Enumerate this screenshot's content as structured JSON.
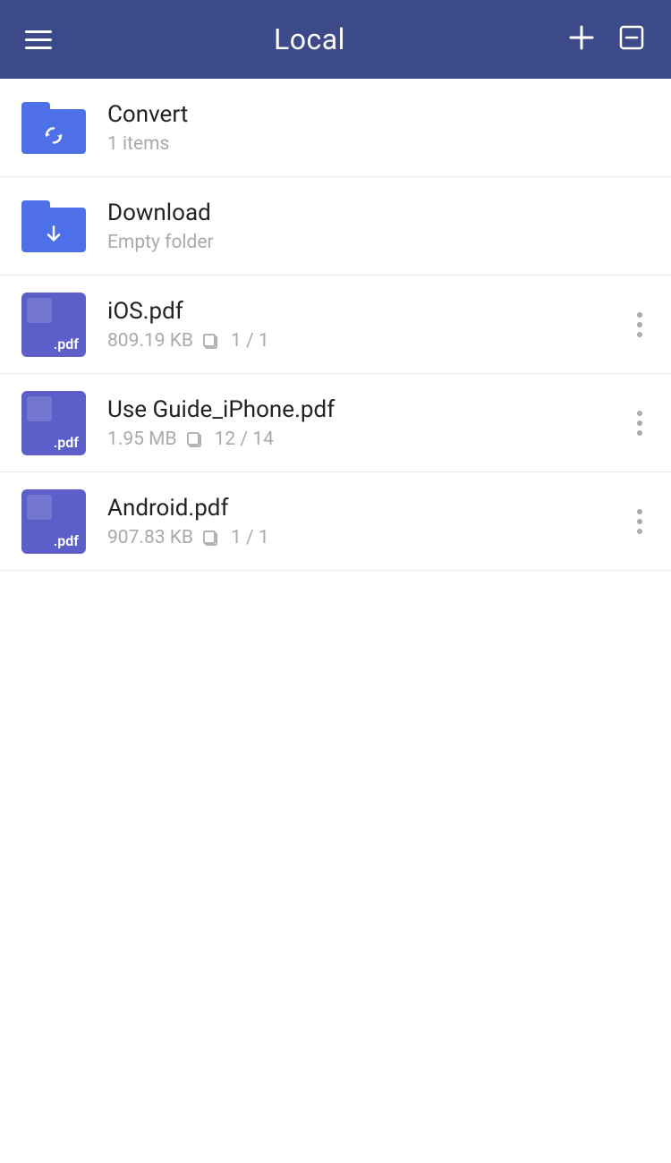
{
  "header": {
    "title": "Local",
    "menu_icon": "hamburger-icon",
    "add_icon": "+",
    "edit_icon": "edit-icon"
  },
  "items": [
    {
      "id": "convert",
      "type": "folder",
      "folder_variant": "sync",
      "name": "Convert",
      "meta": "1 items",
      "show_more": false
    },
    {
      "id": "download",
      "type": "folder",
      "folder_variant": "download",
      "name": "Download",
      "meta": "Empty folder",
      "show_more": false
    },
    {
      "id": "ios-pdf",
      "type": "pdf",
      "name": "iOS.pdf",
      "size": "809.19 KB",
      "pages": "1 / 1",
      "show_more": true
    },
    {
      "id": "use-guide",
      "type": "pdf",
      "name": "Use Guide_iPhone.pdf",
      "size": "1.95 MB",
      "pages": "12 / 14",
      "show_more": true
    },
    {
      "id": "android-pdf",
      "type": "pdf",
      "name": "Android.pdf",
      "size": "907.83 KB",
      "pages": "1 / 1",
      "show_more": true
    }
  ]
}
